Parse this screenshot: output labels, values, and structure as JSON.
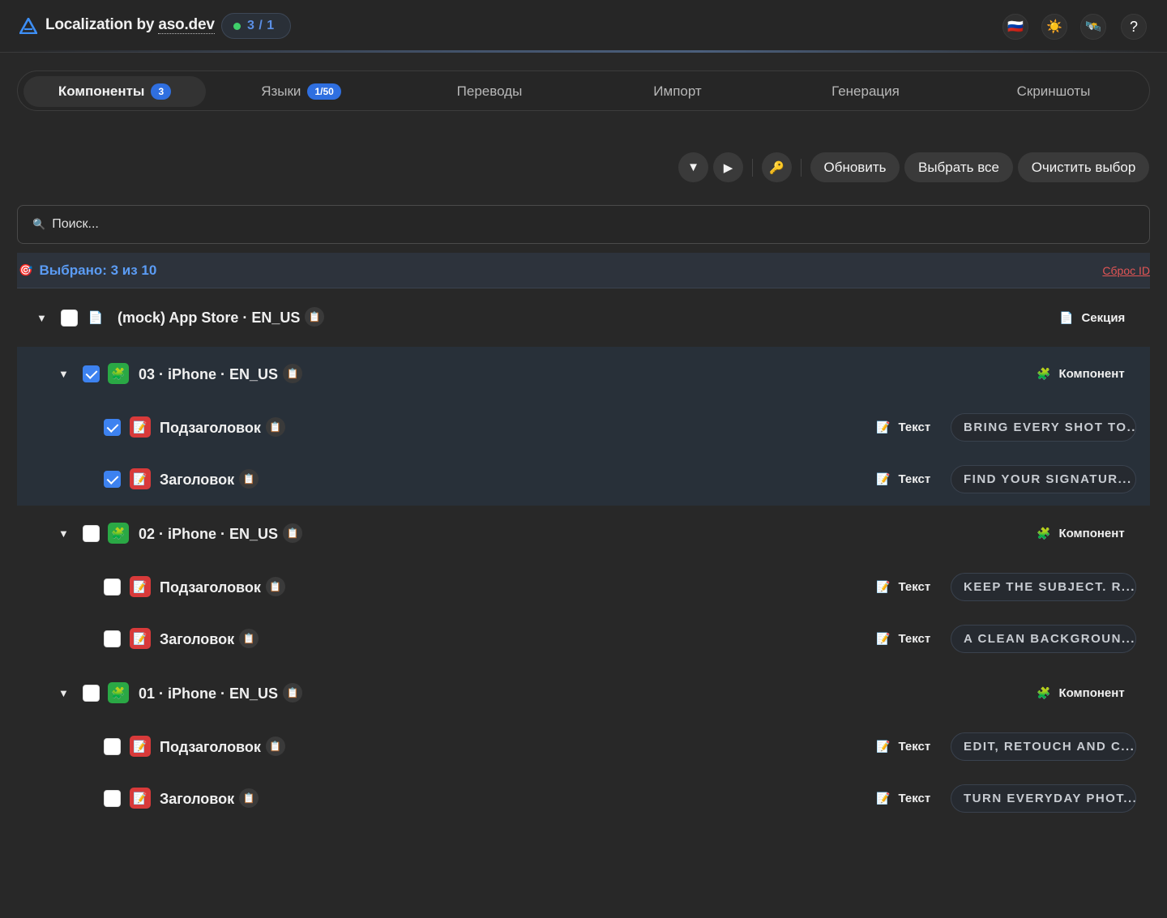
{
  "header": {
    "app_title_prefix": "Localization by ",
    "app_title_link": "aso.dev",
    "counter": "3 / 1",
    "buttons": {
      "flag": "🇷🇺",
      "theme": "☀️",
      "tools": "🛰️",
      "help": "?"
    }
  },
  "tabs": [
    {
      "label": "Компоненты",
      "badge": "3",
      "active": true
    },
    {
      "label": "Языки",
      "badge": "1/50"
    },
    {
      "label": "Переводы"
    },
    {
      "label": "Импорт"
    },
    {
      "label": "Генерация"
    },
    {
      "label": "Скриншоты"
    }
  ],
  "toolbar": {
    "collapse_icon": "▼",
    "expand_icon": "▶",
    "key_icon": "🔑",
    "refresh": "Обновить",
    "select_all": "Выбрать все",
    "clear": "Очистить выбор"
  },
  "search": {
    "icon": "🔍",
    "placeholder": "Поиск..."
  },
  "selection": {
    "icon": "🎯",
    "text": "Выбрано: 3 из 10",
    "reset": "Сброс ID"
  },
  "icons": {
    "clip": "📋",
    "puzzle": "🧩",
    "memo": "📝",
    "doc": "📄",
    "arrow": "▼"
  },
  "tree": {
    "section": {
      "label": "(mock) App Store · EN_US",
      "type": "Секция",
      "checked": false
    },
    "components": [
      {
        "label": "03 · iPhone · EN_US",
        "type": "Компонент",
        "checked": true,
        "items": [
          {
            "label": "Подзаголовок",
            "type": "Текст",
            "value": "BRING EVERY SHOT TO...",
            "checked": true
          },
          {
            "label": "Заголовок",
            "type": "Текст",
            "value": "FIND YOUR SIGNATUR...",
            "checked": true
          }
        ]
      },
      {
        "label": "02 · iPhone · EN_US",
        "type": "Компонент",
        "checked": false,
        "items": [
          {
            "label": "Подзаголовок",
            "type": "Текст",
            "value": "KEEP THE SUBJECT. R...",
            "checked": false
          },
          {
            "label": "Заголовок",
            "type": "Текст",
            "value": "A CLEAN BACKGROUN...",
            "checked": false
          }
        ]
      },
      {
        "label": "01 · iPhone · EN_US",
        "type": "Компонент",
        "checked": false,
        "items": [
          {
            "label": "Подзаголовок",
            "type": "Текст",
            "value": "EDIT, RETOUCH AND C...",
            "checked": false
          },
          {
            "label": "Заголовок",
            "type": "Текст",
            "value": "TURN EVERYDAY PHOT...",
            "checked": false
          }
        ]
      }
    ]
  },
  "colors": {
    "accent": "#2f6fe0",
    "selection_text": "#5b9cf5",
    "reset": "#e25555",
    "status_dot": "#3fcf6a"
  }
}
